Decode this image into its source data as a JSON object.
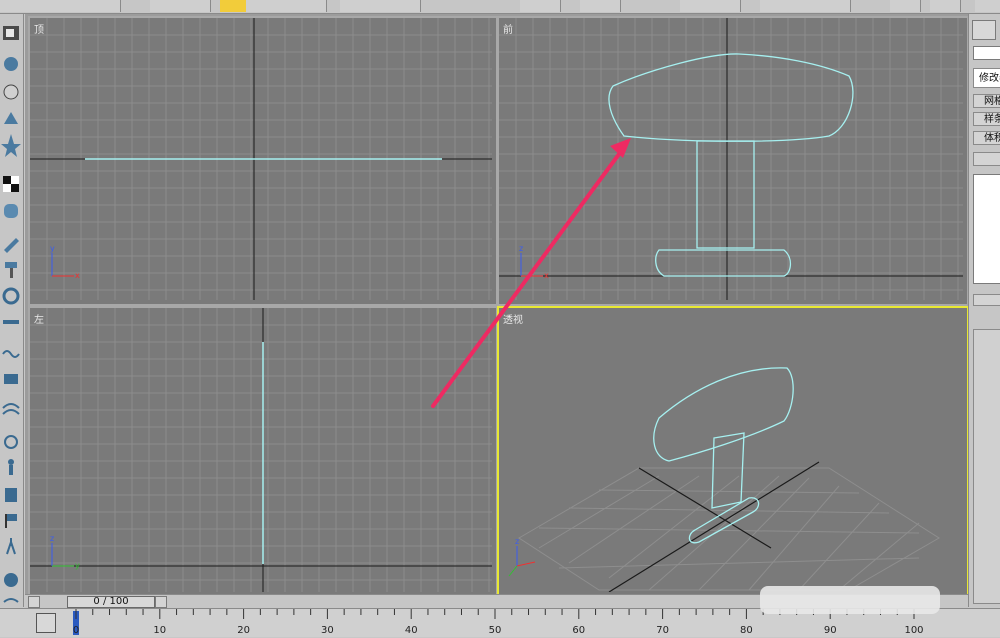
{
  "viewports": {
    "top": {
      "label": "顶"
    },
    "front": {
      "label": "前"
    },
    "left": {
      "label": "左"
    },
    "perspective": {
      "label": "透视"
    }
  },
  "right_panel": {
    "tab_label": "修改器",
    "items": [
      "网格",
      "样条",
      "体积"
    ]
  },
  "time_slider": {
    "value": "0 / 100"
  },
  "timeline": {
    "ticks": [
      "0",
      "10",
      "20",
      "30",
      "40",
      "50",
      "60",
      "70",
      "80",
      "90",
      "100"
    ]
  },
  "axis_labels": {
    "x": "x",
    "y": "y",
    "z": "z"
  },
  "colors": {
    "viewport_bg": "#7a7a7a",
    "grid": "#8e8e8e",
    "wire": "#a6f0f0",
    "active_border": "#e8e832",
    "arrow": "#ee2a62"
  },
  "icons": {
    "top_toolbar": [
      "select-arrow-icon",
      "select-region-icon",
      "move-icon",
      "rotate-icon",
      "scale-icon",
      "snap-icon"
    ],
    "left_toolbar": [
      "create-box-icon",
      "teapot-icon",
      "sphere-icon",
      "cone-icon",
      "star-icon",
      "checker-icon",
      "cylinder-icon",
      "pencil-icon",
      "torus-icon",
      "gear-icon",
      "bone-icon",
      "wave-icon",
      "camera-icon",
      "light-icon",
      "hand-icon",
      "clip-icon"
    ]
  }
}
